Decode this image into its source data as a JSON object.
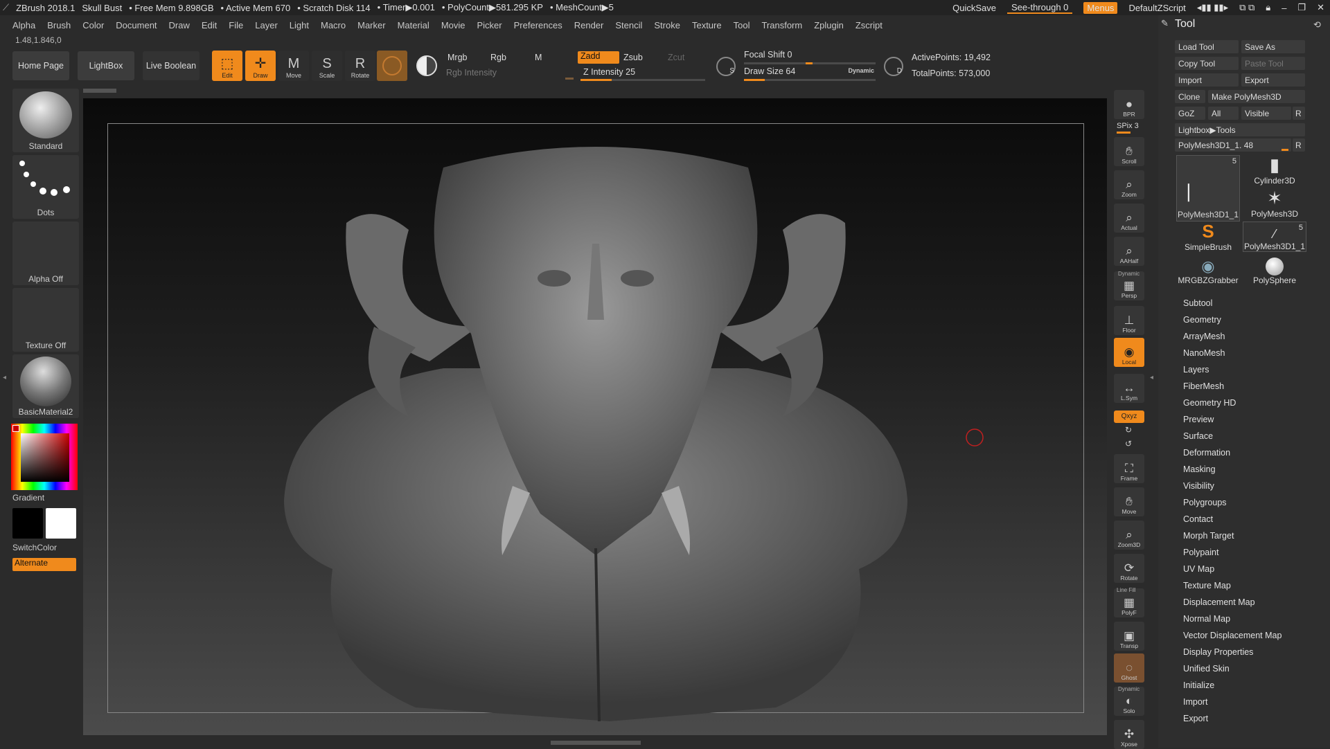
{
  "titlebar": {
    "app": "ZBrush 2018.1",
    "project": "Skull Bust",
    "free_mem": "• Free Mem 9.898GB",
    "active_mem": "• Active Mem 670",
    "scratch": "• Scratch Disk 114",
    "timer": "• Timer▶0.001",
    "polycount": "• PolyCount▶581.295 KP",
    "meshcount": "• MeshCount▶5",
    "quicksave": "QuickSave",
    "seethrough": "See-through  0",
    "menus": "Menus",
    "script": "DefaultZScript"
  },
  "menu": [
    "Alpha",
    "Brush",
    "Color",
    "Document",
    "Draw",
    "Edit",
    "File",
    "Layer",
    "Light",
    "Macro",
    "Marker",
    "Material",
    "Movie",
    "Picker",
    "Preferences",
    "Render",
    "Stencil",
    "Stroke",
    "Texture",
    "Tool",
    "Transform",
    "Zplugin",
    "Zscript"
  ],
  "coords": "1.48,1.846,0",
  "shelf": {
    "home": "Home Page",
    "lightbox": "LightBox",
    "liveboolean": "Live Boolean",
    "edit": "Edit",
    "draw": "Draw",
    "move": "Move",
    "scale": "Scale",
    "rotate": "Rotate",
    "mrgb": "Mrgb",
    "rgb": "Rgb",
    "m": "M",
    "zadd": "Zadd",
    "zsub": "Zsub",
    "zcut": "Zcut",
    "rgb_intensity": "Rgb Intensity",
    "z_intensity": "Z Intensity 25",
    "focal_shift": "Focal Shift 0",
    "draw_size": "Draw Size 64",
    "dynamic": "Dynamic",
    "active_points": "ActivePoints: 19,492",
    "total_points": "TotalPoints: 573,000",
    "z_intensity_level": 0.25,
    "draw_size_level": 0.16,
    "focal_shift_level": 0.5
  },
  "left": {
    "brush": "Standard",
    "stroke": "Dots",
    "alpha": "Alpha Off",
    "texture": "Texture Off",
    "material": "BasicMaterial2",
    "gradient": "Gradient",
    "switchcolor": "SwitchColor",
    "alternate": "Alternate"
  },
  "right_shelf": [
    {
      "name": "bpr",
      "label": "BPR",
      "icon": "sphere-icon"
    },
    {
      "name": "scroll",
      "label": "Scroll",
      "icon": "hand-icon"
    },
    {
      "name": "zoom",
      "label": "Zoom",
      "icon": "magnifier-icon"
    },
    {
      "name": "actual",
      "label": "Actual",
      "icon": "magnifier-icon"
    },
    {
      "name": "aahalf",
      "label": "AAHalf",
      "icon": "magnifier-icon"
    },
    {
      "name": "persp",
      "label": "Persp",
      "icon": "grid-icon"
    },
    {
      "name": "floor",
      "label": "Floor",
      "icon": "floor-icon"
    },
    {
      "name": "local",
      "label": "Local",
      "icon": "local-icon"
    },
    {
      "name": "lsym",
      "label": "L.Sym",
      "icon": "symmetry-icon"
    },
    {
      "name": "frame",
      "label": "Frame",
      "icon": "frame-icon"
    },
    {
      "name": "move",
      "label": "Move",
      "icon": "hand-icon"
    },
    {
      "name": "zoom3d",
      "label": "Zoom3D",
      "icon": "magnifier-icon"
    },
    {
      "name": "rotate",
      "label": "Rotate",
      "icon": "rotate-icon"
    },
    {
      "name": "polyf",
      "label": "PolyF",
      "icon": "grid-icon"
    },
    {
      "name": "transp",
      "label": "Transp",
      "icon": "transp-icon"
    },
    {
      "name": "ghost",
      "label": "Ghost",
      "icon": "ghost-icon"
    },
    {
      "name": "solo",
      "label": "Solo",
      "icon": "solo-icon"
    },
    {
      "name": "xpose",
      "label": "Xpose",
      "icon": "xpose-icon"
    }
  ],
  "right_extra": {
    "spix": "SPix 3",
    "dynamic": "Dynamic",
    "linefill": "Line Fill",
    "xyz": "Qxyz"
  },
  "tool": {
    "title": "Tool",
    "load": "Load Tool",
    "saveas": "Save As",
    "copy": "Copy Tool",
    "paste": "Paste Tool",
    "import": "Import",
    "export": "Export",
    "clone": "Clone",
    "make": "Make PolyMesh3D",
    "goz": "GoZ",
    "all": "All",
    "visible": "Visible",
    "r": "R",
    "lightbox": "Lightbox▶Tools",
    "current": "PolyMesh3D1_1. 48",
    "thumbs": [
      {
        "label": "PolyMesh3D1_1",
        "badge": "5"
      },
      {
        "label": "Cylinder3D",
        "badge": ""
      },
      {
        "label": "PolyMesh3D",
        "badge": ""
      },
      {
        "label": "SimpleBrush",
        "badge": ""
      },
      {
        "label": "PolyMesh3D1_1",
        "badge": "5"
      },
      {
        "label": "MRGBZGrabber",
        "badge": ""
      },
      {
        "label": "PolySphere",
        "badge": ""
      }
    ],
    "sections": [
      "Subtool",
      "Geometry",
      "ArrayMesh",
      "NanoMesh",
      "Layers",
      "FiberMesh",
      "Geometry HD",
      "Preview",
      "Surface",
      "Deformation",
      "Masking",
      "Visibility",
      "Polygroups",
      "Contact",
      "Morph Target",
      "Polypaint",
      "UV Map",
      "Texture Map",
      "Displacement Map",
      "Normal Map",
      "Vector Displacement Map",
      "Display Properties",
      "Unified Skin",
      "Initialize",
      "Import",
      "Export"
    ]
  }
}
